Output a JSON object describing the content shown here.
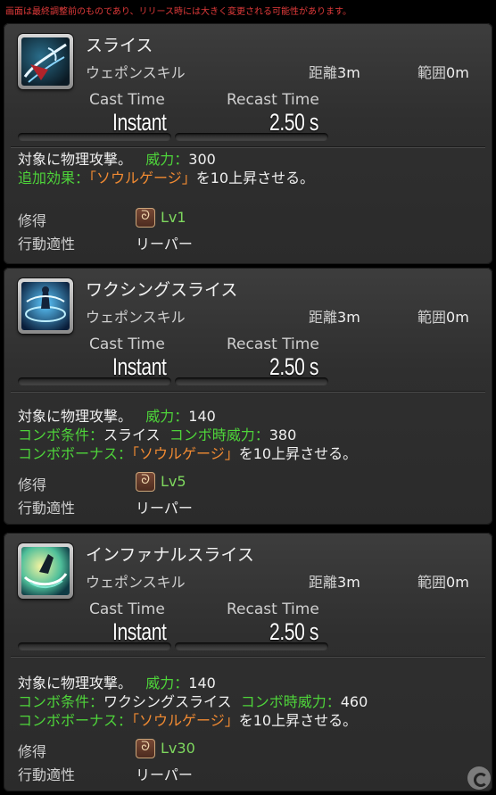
{
  "notice": "画面は最終調整前のものであり、リリース時には大きく変更される可能性があります。",
  "labels": {
    "cast_time": "Cast Time",
    "recast_time": "Recast Time",
    "range": "距離",
    "radius": "範囲",
    "acquired": "修得",
    "affinity": "行動適性"
  },
  "actions": [
    {
      "name": "スライス",
      "icon": "slice-icon",
      "type": "ウェポンスキル",
      "range": "3m",
      "radius": "0m",
      "cast": "Instant",
      "recast": "2.50 s",
      "desc1": {
        "text": "対象に物理攻撃。",
        "potency_label": "威力：",
        "potency": "300"
      },
      "desc2": {
        "effect_label": "追加効果：",
        "gauge": "「ソウルゲージ」",
        "tail": "を10上昇させる。"
      },
      "job_icon": "reaper-job-icon",
      "level": "Lv1",
      "job": "リーパー"
    },
    {
      "name": "ワクシングスライス",
      "icon": "waxing-slice-icon",
      "type": "ウェポンスキル",
      "range": "3m",
      "radius": "0m",
      "cast": "Instant",
      "recast": "2.50 s",
      "desc1": {
        "text": "対象に物理攻撃。",
        "potency_label": "威力：",
        "potency": "140"
      },
      "combo": {
        "cond_label": "コンボ条件：",
        "cond": "スライス",
        "pot_label": "コンボ時威力：",
        "pot": "380"
      },
      "desc2": {
        "effect_label": "コンボボーナス：",
        "gauge": "「ソウルゲージ」",
        "tail": "を10上昇させる。"
      },
      "job_icon": "reaper-job-icon",
      "level": "Lv5",
      "job": "リーパー"
    },
    {
      "name": "インファナルスライス",
      "icon": "infernal-slice-icon",
      "type": "ウェポンスキル",
      "range": "3m",
      "radius": "0m",
      "cast": "Instant",
      "recast": "2.50 s",
      "desc1": {
        "text": "対象に物理攻撃。",
        "potency_label": "威力：",
        "potency": "140"
      },
      "combo": {
        "cond_label": "コンボ条件：",
        "cond": "ワクシングスライス",
        "pot_label": "コンボ時威力：",
        "pot": "460"
      },
      "desc2": {
        "effect_label": "コンボボーナス：",
        "gauge": "「ソウルゲージ」",
        "tail": "を10上昇させる。"
      },
      "job_icon": "reaper-job-icon",
      "level": "Lv30",
      "job": "リーパー"
    }
  ],
  "colors": {
    "green_text": "#4ed43a",
    "orange_text": "#f08a32",
    "notice_red": "#e03a3a",
    "level_green": "#7ed85e"
  },
  "watermark_icon": "gamer-logo-icon"
}
